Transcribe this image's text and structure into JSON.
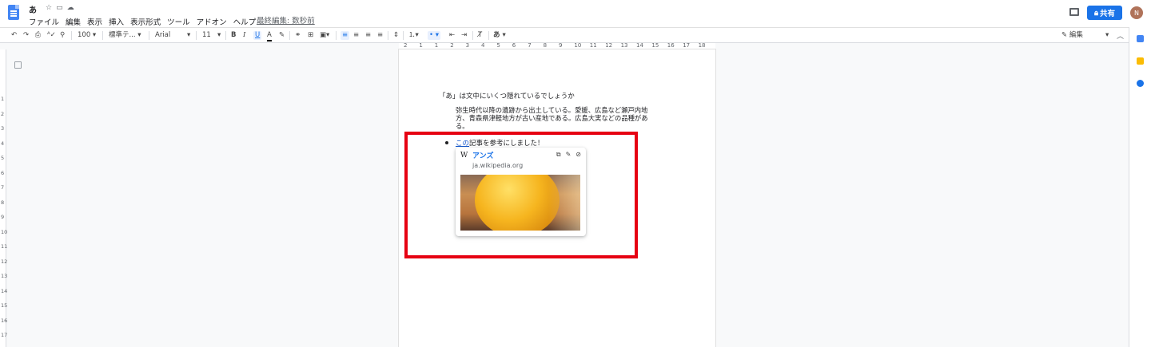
{
  "doc": {
    "title": "あ"
  },
  "menu": [
    "ファイル",
    "編集",
    "表示",
    "挿入",
    "表示形式",
    "ツール",
    "アドオン",
    "ヘルプ"
  ],
  "last_edit": "最終編集: 数秒前",
  "share_label": "共有",
  "avatar_letter": "N",
  "toolbar": {
    "zoom": "100",
    "style": "標準テ...",
    "font": "Arial",
    "font_size": "11",
    "bold": "B",
    "italic": "I",
    "underline": "U",
    "text_color": "A",
    "input_lang": "あ",
    "mode": "編集"
  },
  "ruler_labels": [
    "2",
    "1",
    "1",
    "2",
    "3",
    "4",
    "5",
    "6",
    "7",
    "8",
    "9",
    "10",
    "11",
    "12",
    "13",
    "14",
    "15",
    "16",
    "17",
    "18"
  ],
  "vruler_labels": [
    "1",
    "2",
    "3",
    "4",
    "5",
    "6",
    "7",
    "8",
    "9",
    "10",
    "11",
    "12",
    "13",
    "14",
    "15",
    "16",
    "17"
  ],
  "content": {
    "heading": "「あ」は文中にいくつ隠れているでしょうか",
    "paragraph_lines": [
      "弥生時代以降の遺跡から出土している。愛媛、広島など瀬戸内地",
      "方、青森県津軽地方が古い産地である。広島大実などの品種があ",
      "る。"
    ],
    "bullet_link": "この",
    "bullet_rest": "記事を参考にしました！"
  },
  "preview": {
    "site_icon": "W",
    "title": "アンズ",
    "domain": "ja.wikipedia.org",
    "image_alt": "apricot-photo"
  },
  "colors": {
    "accent": "#1a73e8",
    "link": "#1155cc",
    "highlight_box": "#e60012"
  }
}
